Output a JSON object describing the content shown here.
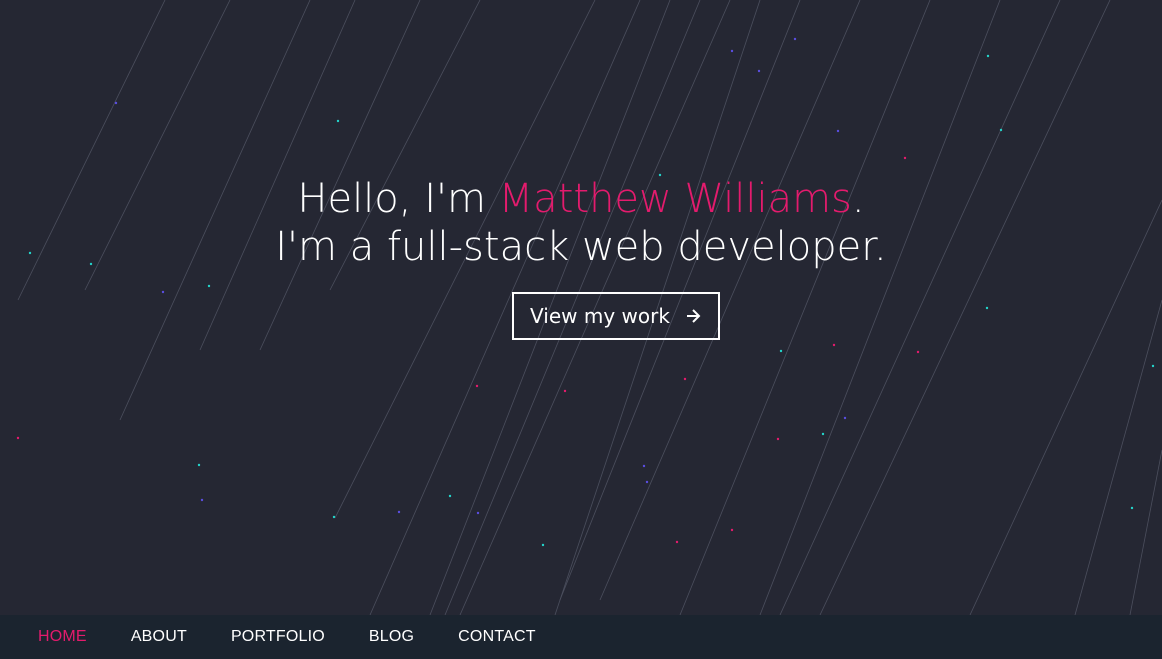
{
  "hero": {
    "greeting_prefix": "Hello, I'm ",
    "name": "Matthew Williams",
    "greeting_suffix": ".",
    "tagline": "I'm a full-stack web developer.",
    "cta_label": "View my work",
    "cta_icon": "arrow-right-icon"
  },
  "colors": {
    "background": "#252733",
    "accent": "#e31b6d",
    "navbar": "#1b242f",
    "text": "#ffffff"
  },
  "nav": {
    "items": [
      {
        "label": "HOME",
        "active": true
      },
      {
        "label": "ABOUT",
        "active": false
      },
      {
        "label": "PORTFOLIO",
        "active": false
      },
      {
        "label": "BLOG",
        "active": false
      },
      {
        "label": "CONTACT",
        "active": false
      }
    ]
  }
}
